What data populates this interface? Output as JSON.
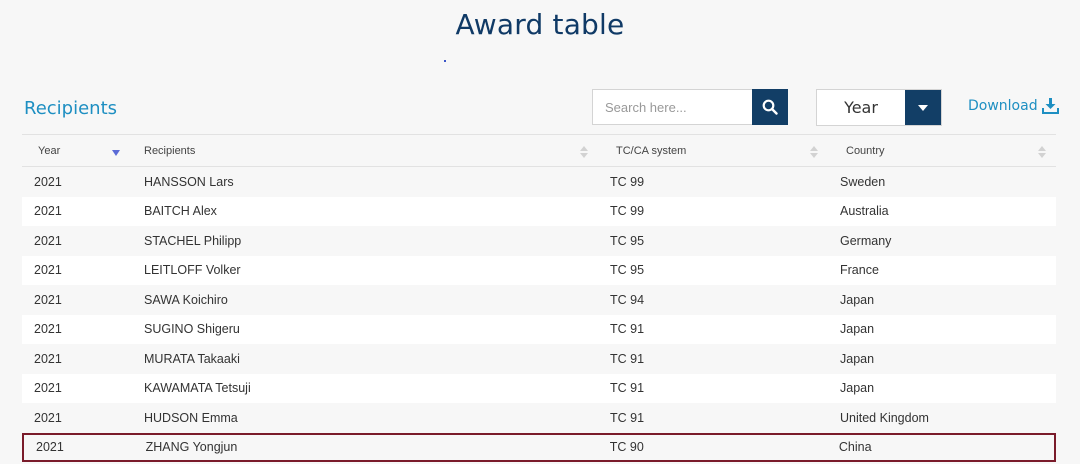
{
  "page": {
    "title": "Award table"
  },
  "section": {
    "title": "Recipients"
  },
  "search": {
    "placeholder": "Search here...",
    "value": ""
  },
  "year_filter": {
    "selected": "Year"
  },
  "download": {
    "label": "Download"
  },
  "icons": {
    "search": "search-icon",
    "caret": "caret-down-icon",
    "download": "download-icon",
    "sort": "sort-icon"
  },
  "colors": {
    "navy": "#123e66",
    "accent_blue": "#1e8fc2",
    "selected_border": "#7a1b2a",
    "sort_active": "#5b6bd6"
  },
  "table": {
    "columns": [
      "Year",
      "Recipients",
      "TC/CA system",
      "Country"
    ],
    "rows": [
      {
        "year": "2021",
        "recipient": "HANSSON Lars",
        "tc": "TC 99",
        "country": "Sweden"
      },
      {
        "year": "2021",
        "recipient": "BAITCH Alex",
        "tc": "TC 99",
        "country": "Australia"
      },
      {
        "year": "2021",
        "recipient": "STACHEL Philipp",
        "tc": "TC 95",
        "country": "Germany"
      },
      {
        "year": "2021",
        "recipient": "LEITLOFF Volker",
        "tc": "TC 95",
        "country": "France"
      },
      {
        "year": "2021",
        "recipient": "SAWA Koichiro",
        "tc": "TC 94",
        "country": "Japan"
      },
      {
        "year": "2021",
        "recipient": "SUGINO Shigeru",
        "tc": "TC 91",
        "country": "Japan"
      },
      {
        "year": "2021",
        "recipient": "MURATA Takaaki",
        "tc": "TC 91",
        "country": "Japan"
      },
      {
        "year": "2021",
        "recipient": "KAWAMATA Tetsuji",
        "tc": "TC 91",
        "country": "Japan"
      },
      {
        "year": "2021",
        "recipient": "HUDSON Emma",
        "tc": "TC 91",
        "country": "United Kingdom"
      },
      {
        "year": "2021",
        "recipient": "ZHANG Yongjun",
        "tc": "TC 90",
        "country": "China"
      }
    ]
  }
}
